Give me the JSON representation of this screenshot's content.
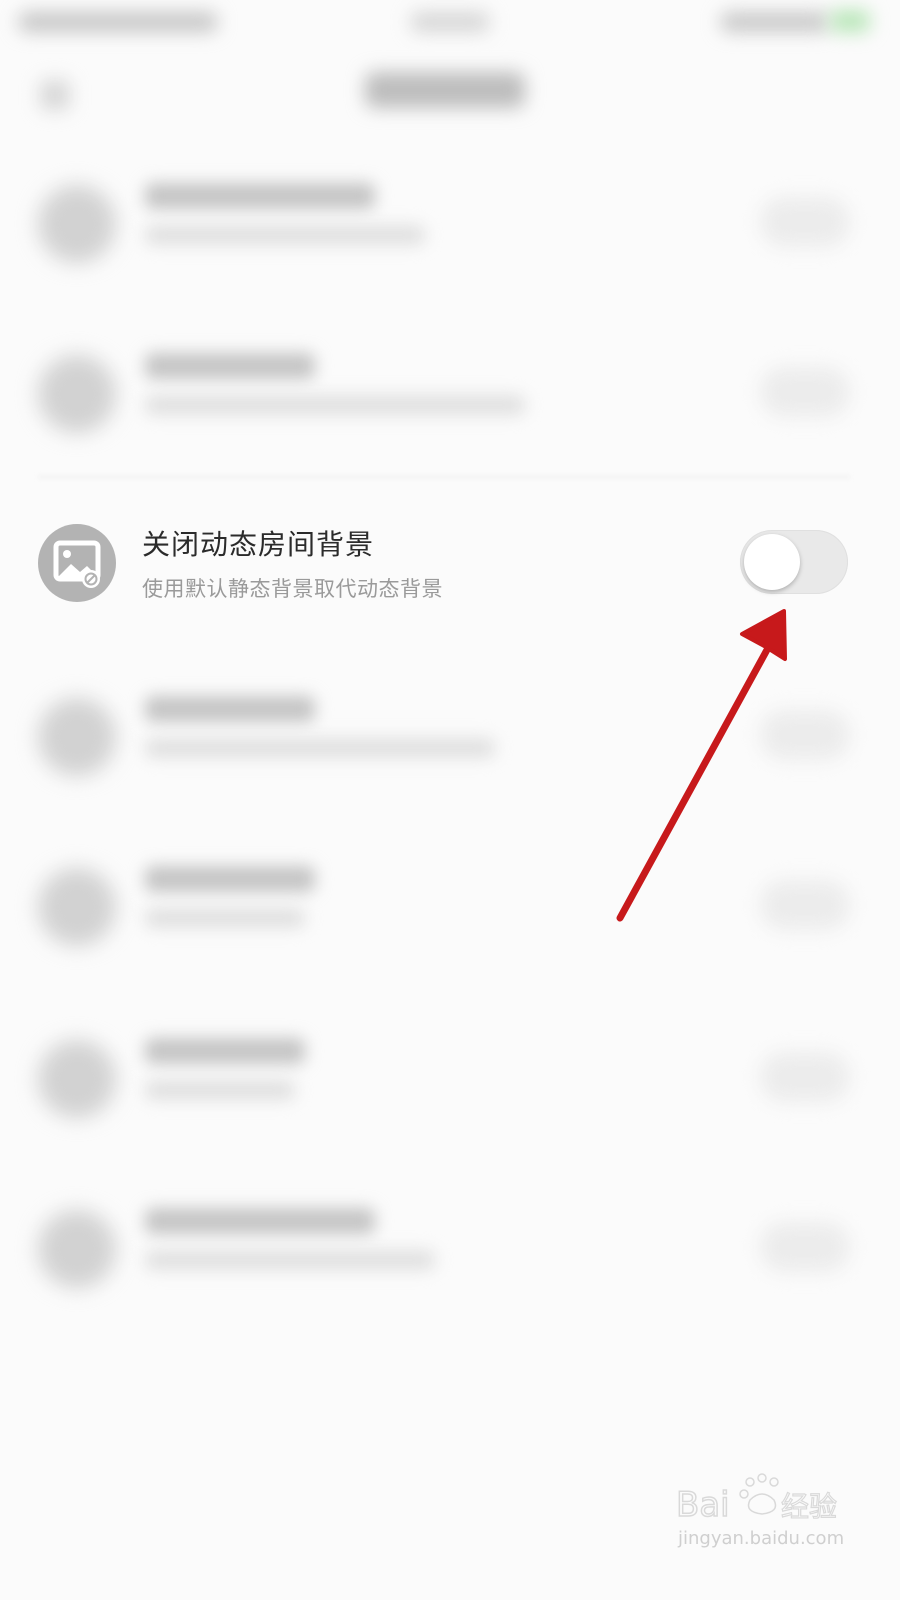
{
  "setting": {
    "title": "关闭动态房间背景",
    "subtitle": "使用默认静态背景取代动态背景",
    "icon": "image-icon",
    "toggle_on": false
  },
  "annotation": {
    "type": "arrow",
    "color": "#c7191b"
  },
  "watermark": {
    "logo": "Baidu经验",
    "url": "jingyan.baidu.com"
  },
  "colors": {
    "background": "#fbfbfb",
    "toggle_track_off": "#e9e9e9",
    "icon_bg": "#b3b3b3"
  }
}
